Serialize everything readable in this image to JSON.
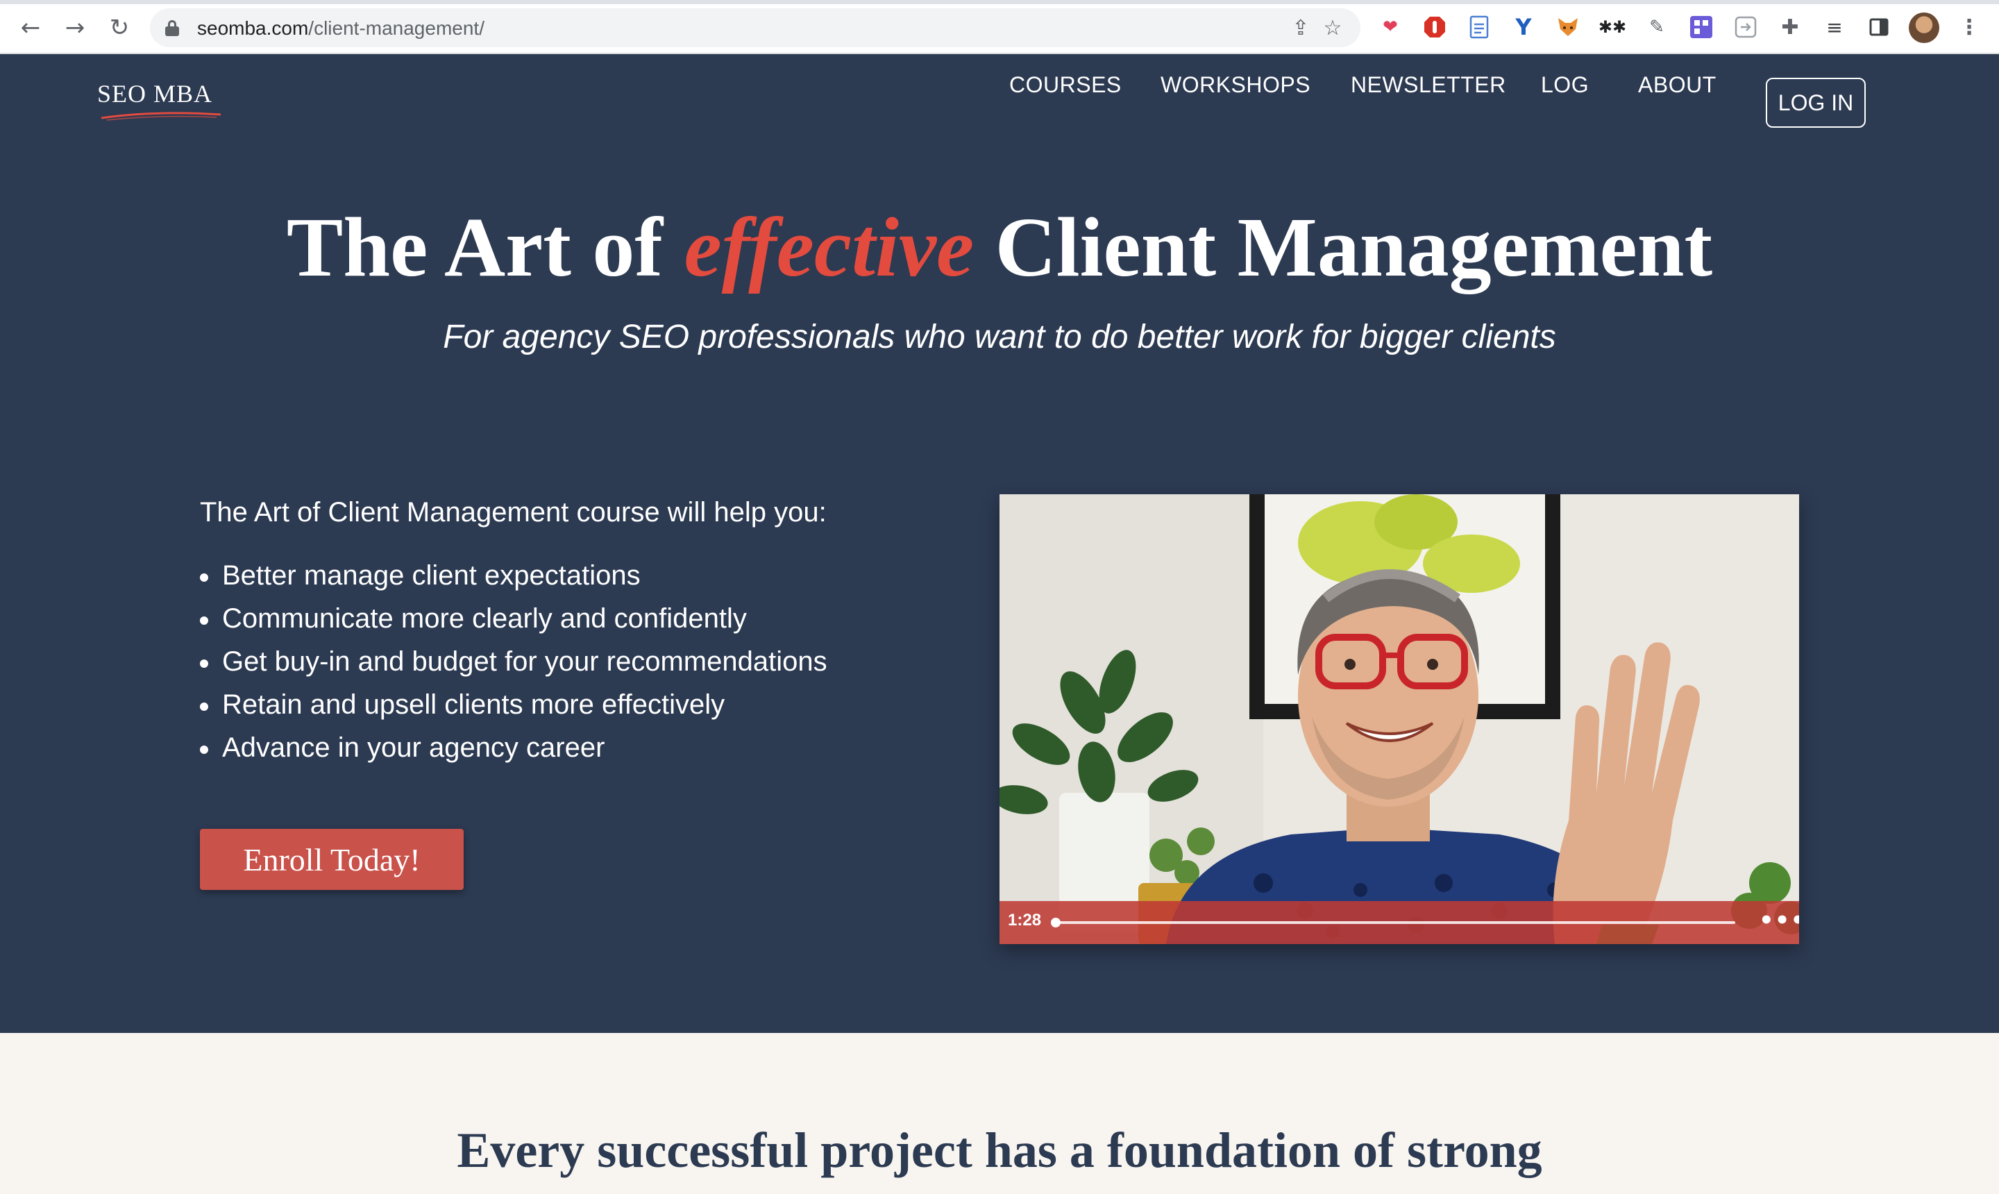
{
  "browser": {
    "url_host": "seomba.com",
    "url_path": "/client-management/",
    "icons": {
      "back": "arrow-left-icon",
      "forward": "arrow-right-icon",
      "reload": "reload-icon",
      "share": "share-icon",
      "bookmark": "star-icon",
      "extensions": "puzzle-icon",
      "menu": "kebab-menu-icon"
    }
  },
  "site": {
    "logo": "SEO MBA",
    "nav": [
      "COURSES",
      "WORKSHOPS",
      "NEWSLETTER",
      "LOG",
      "ABOUT"
    ],
    "login": "LOG IN"
  },
  "hero": {
    "title_before": "The Art of ",
    "title_accent": "effective",
    "title_after": " Client Management",
    "subtitle": "For agency SEO professionals who want to do better work for bigger clients",
    "intro": "The Art of Client Management course will help you:",
    "bullets": [
      "Better manage client expectations",
      "Communicate more clearly and confidently",
      "Get buy-in and budget for your recommendations",
      "Retain and upsell clients more effectively",
      "Advance in your agency career"
    ],
    "cta": "Enroll Today!"
  },
  "video": {
    "time": "1:28",
    "more": "•••"
  },
  "lower": {
    "heading": "Every successful project has a foundation of strong"
  },
  "colors": {
    "hero_bg": "#2c3a52",
    "accent": "#e24b3e",
    "button": "#c9524a",
    "cream": "#f8f5f0"
  }
}
